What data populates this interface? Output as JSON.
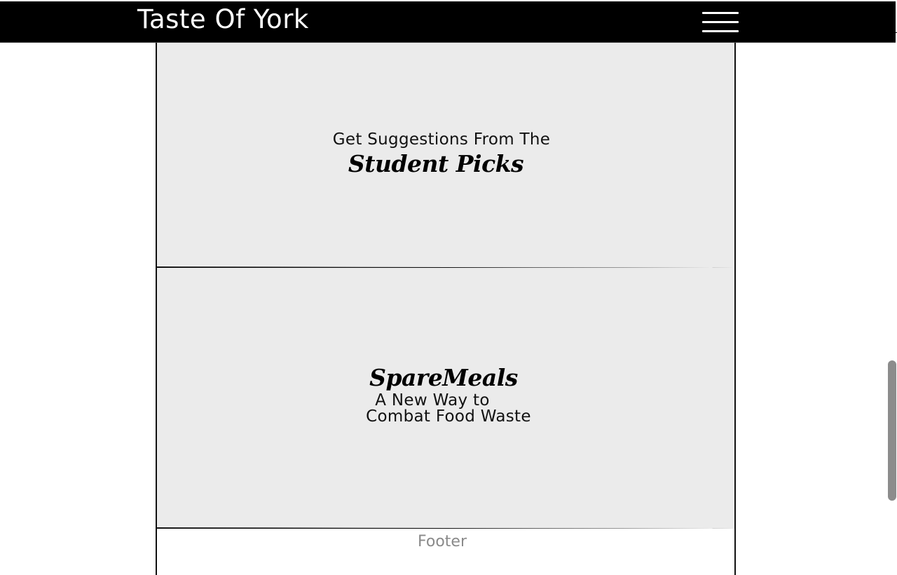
{
  "header": {
    "title": "Taste Of York",
    "menu_icon": "hamburger-menu-icon"
  },
  "sections": {
    "student_picks": {
      "lead": "Get Suggestions From The",
      "script_title": "Student Picks"
    },
    "spare_meals": {
      "script_title": "SpareMeals",
      "line1": "A New Way to",
      "line2": "Combat Food Waste"
    }
  },
  "footer": {
    "label": "Footer"
  },
  "colors": {
    "header_bg": "#000000",
    "panel_bg": "#ebebeb",
    "footer_text": "#8a8a8a"
  }
}
